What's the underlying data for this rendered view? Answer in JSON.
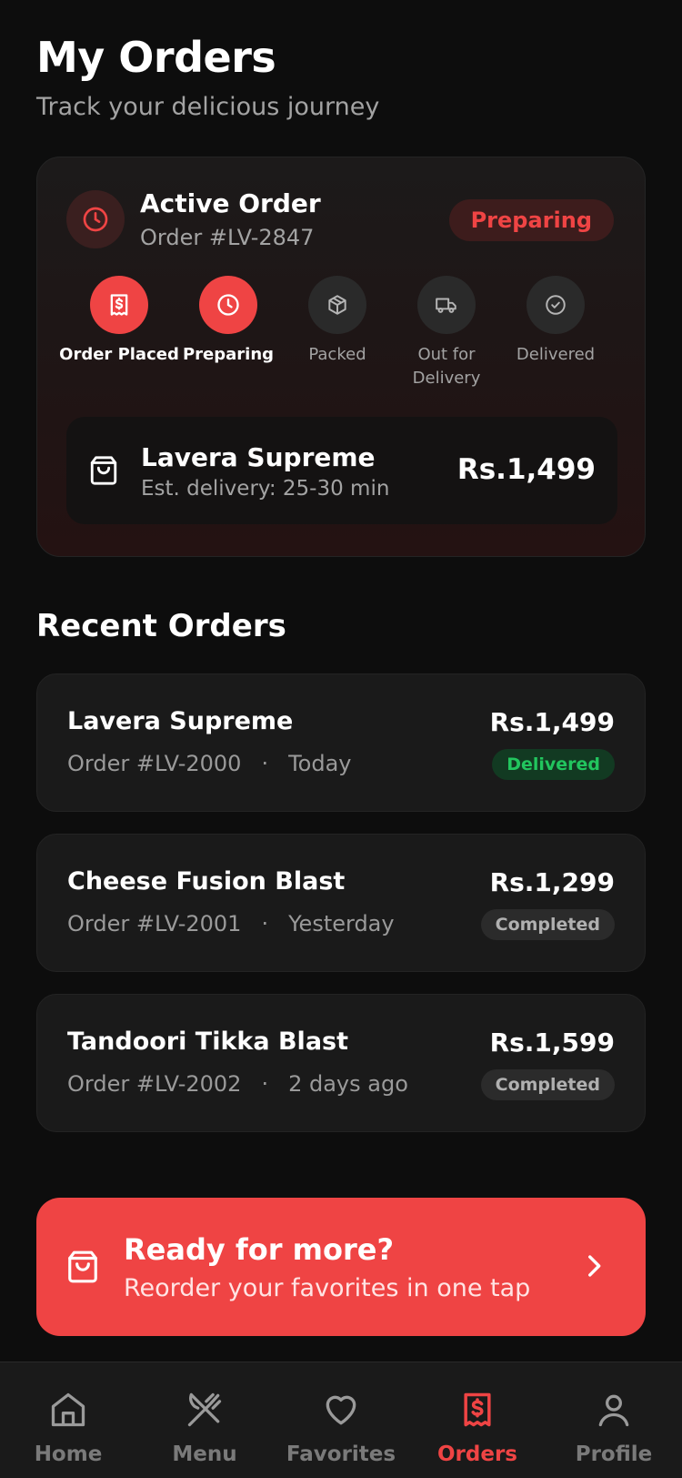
{
  "header": {
    "title": "My Orders",
    "subtitle": "Track your delicious journey"
  },
  "active_order": {
    "title": "Active Order",
    "order_number": "Order #LV-2847",
    "status": "Preparing",
    "steps": [
      {
        "label": "Order Placed",
        "icon": "receipt-icon",
        "active": true
      },
      {
        "label": "Preparing",
        "icon": "clock-icon",
        "active": true
      },
      {
        "label": "Packed",
        "icon": "package-icon",
        "active": false
      },
      {
        "label": "Out for Delivery",
        "icon": "truck-icon",
        "active": false
      },
      {
        "label": "Delivered",
        "icon": "check-circle-icon",
        "active": false
      }
    ],
    "summary": {
      "item_name": "Lavera Supreme",
      "eta": "Est. delivery: 25-30 min",
      "price": "Rs.1,499"
    }
  },
  "recent": {
    "title": "Recent Orders",
    "orders": [
      {
        "name": "Lavera Supreme",
        "order_number": "Order #LV-2000",
        "when": "Today",
        "price": "Rs.1,499",
        "status": "Delivered"
      },
      {
        "name": "Cheese Fusion Blast",
        "order_number": "Order #LV-2001",
        "when": "Yesterday",
        "price": "Rs.1,299",
        "status": "Completed"
      },
      {
        "name": "Tandoori Tikka Blast",
        "order_number": "Order #LV-2002",
        "when": "2 days ago",
        "price": "Rs.1,599",
        "status": "Completed"
      }
    ]
  },
  "cta": {
    "title": "Ready for more?",
    "subtitle": "Reorder your favorites in one tap"
  },
  "nav": {
    "items": [
      {
        "label": "Home",
        "icon": "home-icon",
        "active": false
      },
      {
        "label": "Menu",
        "icon": "utensils-icon",
        "active": false
      },
      {
        "label": "Favorites",
        "icon": "heart-icon",
        "active": false
      },
      {
        "label": "Orders",
        "icon": "receipt-icon",
        "active": true
      },
      {
        "label": "Profile",
        "icon": "user-icon",
        "active": false
      }
    ]
  },
  "colors": {
    "accent": "#ef4444",
    "background": "#0d0d0d",
    "card": "#1a1a1a",
    "delivered": "#22c55e"
  }
}
